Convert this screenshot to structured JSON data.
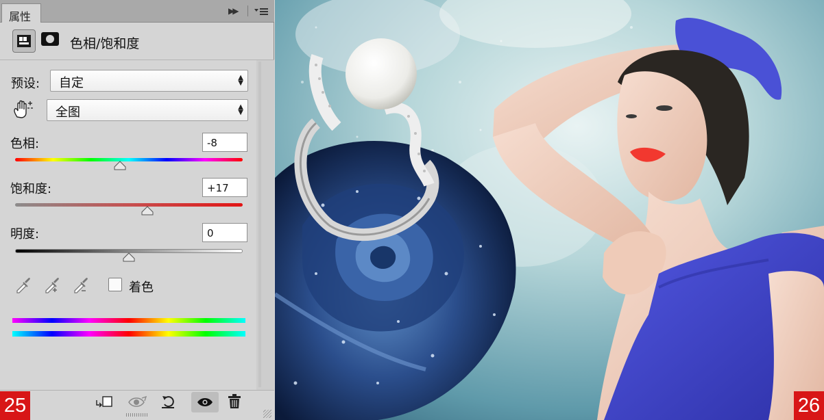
{
  "panel": {
    "tab_label": "属性",
    "title": "色相/饱和度",
    "preset": {
      "label": "预设:",
      "value": "自定"
    },
    "channel": {
      "value": "全图"
    },
    "hue": {
      "label": "色相:",
      "value": "-8",
      "fraction": 0.46
    },
    "saturation": {
      "label": "饱和度:",
      "value": "+17",
      "fraction": 0.58
    },
    "lightness": {
      "label": "明度:",
      "value": "0",
      "fraction": 0.5
    },
    "colorize_label": "着色",
    "colorize_checked": false
  },
  "badges": {
    "left": "25",
    "right": "26"
  },
  "icons": {
    "collapse": "double-arrow-right-icon",
    "panel_menu": "panel-menu-icon",
    "adjustment": "adjustment-layer-icon",
    "mask": "mask-icon",
    "target_adjust": "hand-target-adjust-icon",
    "eyedropper": "eyedropper-icon",
    "eyedropper_add": "eyedropper-plus-icon",
    "eyedropper_sub": "eyedropper-minus-icon",
    "clip": "clip-to-layer-icon",
    "view_previous": "view-previous-state-icon",
    "reset": "reset-icon",
    "visibility": "eye-icon",
    "delete": "trash-icon"
  },
  "colors": {
    "panel_bg": "#d5d5d5",
    "tab_bar_bg": "#a9a9a9",
    "badge_red": "#d81617",
    "dress_blue": "#4b4fd1",
    "lips_red": "#f2382f"
  }
}
